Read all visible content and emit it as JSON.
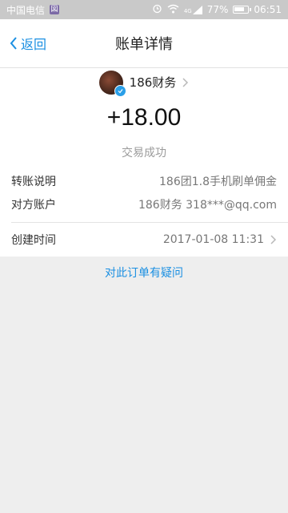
{
  "status_bar": {
    "carrier": "中国电信",
    "sim_badge": "図",
    "battery": "77%",
    "battery_level": 0.77,
    "signal_label": "4G",
    "time": "06:51"
  },
  "nav": {
    "back_label": "返回",
    "title": "账单详情"
  },
  "merchant": {
    "name": "186财务"
  },
  "transaction": {
    "amount": "+18.00",
    "status": "交易成功"
  },
  "details": [
    {
      "label": "转账说明",
      "value": "186团1.8手机刷单佣金"
    },
    {
      "label": "对方账户",
      "value": "186财务 318***@qq.com"
    }
  ],
  "created": {
    "label": "创建时间",
    "value": "2017-01-08 11:31"
  },
  "actions": {
    "question_link": "对此订单有疑问"
  },
  "colors": {
    "accent": "#1a8fe2",
    "status_bar": "#c9c9c9"
  }
}
